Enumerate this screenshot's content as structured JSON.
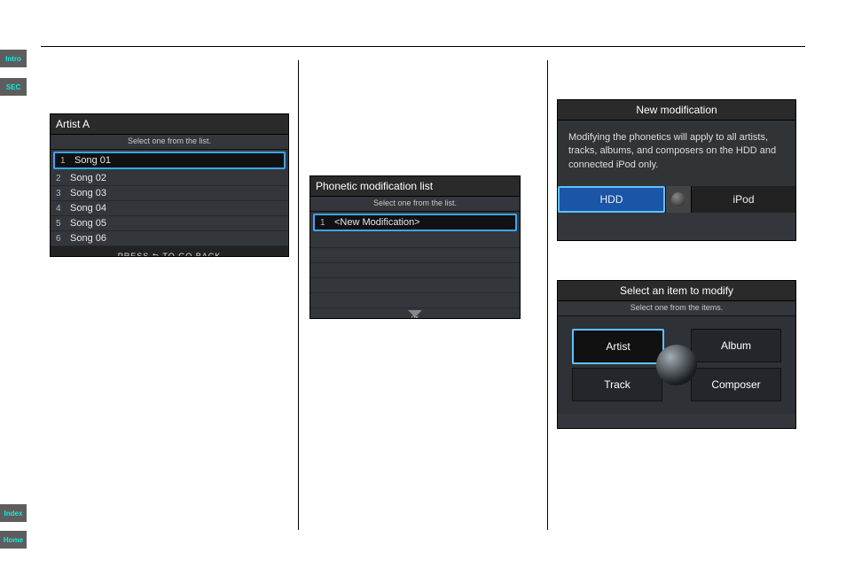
{
  "nav": {
    "intro": "Intro",
    "sec": "SEC",
    "index": "Index",
    "home": "Home"
  },
  "screens": {
    "artist_list": {
      "title": "Artist A",
      "subtitle": "Select one from the list.",
      "items": [
        {
          "num": "1",
          "label": "Song 01"
        },
        {
          "num": "2",
          "label": "Song 02"
        },
        {
          "num": "3",
          "label": "Song 03"
        },
        {
          "num": "4",
          "label": "Song 04"
        },
        {
          "num": "5",
          "label": "Song 05"
        },
        {
          "num": "6",
          "label": "Song 06"
        }
      ],
      "footer": "PRESS ⮌ TO GO BACK"
    },
    "phonetic_list": {
      "title": "Phonetic modification list",
      "subtitle": "Select one from the list.",
      "items": [
        {
          "num": "1",
          "label": "<New Modification>"
        }
      ],
      "ok": "OK"
    },
    "new_mod": {
      "title": "New modification",
      "body": "Modifying the phonetics will apply to all artists, tracks, albums, and composers on the HDD and connected iPod only.",
      "opt_hdd": "HDD",
      "opt_ipod": "iPod"
    },
    "select_item": {
      "title": "Select an item to modify",
      "subtitle": "Select one from the items.",
      "artist": "Artist",
      "album": "Album",
      "track": "Track",
      "composer": "Composer"
    }
  }
}
